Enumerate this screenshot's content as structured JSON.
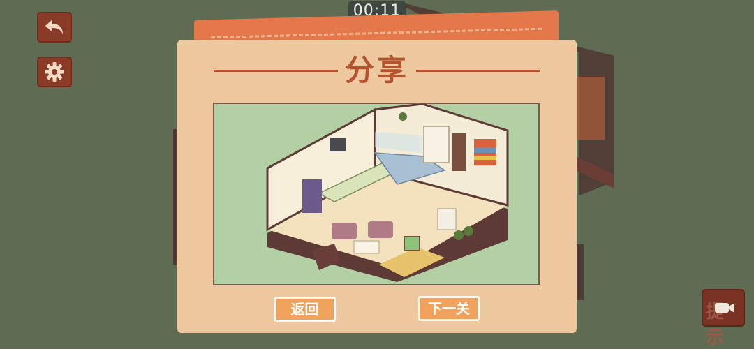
{
  "hud": {
    "timer": "00:11",
    "back_icon": "undo-arrow-icon",
    "settings_icon": "gear-icon",
    "hint_label": "提示",
    "hint_icon": "video-camera-icon"
  },
  "dialog": {
    "title": "分享",
    "preview_icon": "isometric-room-illustration",
    "back_label": "返回",
    "next_label": "下一关"
  },
  "colors": {
    "background": "#5f6b53",
    "dialog": "#eec9a0",
    "accent": "#b5532d",
    "button": "#f0a15c",
    "tab": "#e4784a"
  }
}
